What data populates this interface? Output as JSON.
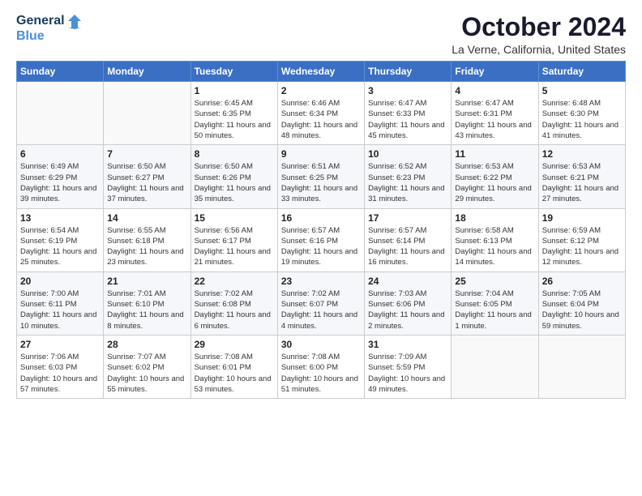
{
  "logo": {
    "text_general": "General",
    "text_blue": "Blue"
  },
  "title": "October 2024",
  "subtitle": "La Verne, California, United States",
  "days_of_week": [
    "Sunday",
    "Monday",
    "Tuesday",
    "Wednesday",
    "Thursday",
    "Friday",
    "Saturday"
  ],
  "weeks": [
    [
      {
        "day": "",
        "info": ""
      },
      {
        "day": "",
        "info": ""
      },
      {
        "day": "1",
        "info": "Sunrise: 6:45 AM\nSunset: 6:35 PM\nDaylight: 11 hours and 50 minutes."
      },
      {
        "day": "2",
        "info": "Sunrise: 6:46 AM\nSunset: 6:34 PM\nDaylight: 11 hours and 48 minutes."
      },
      {
        "day": "3",
        "info": "Sunrise: 6:47 AM\nSunset: 6:33 PM\nDaylight: 11 hours and 45 minutes."
      },
      {
        "day": "4",
        "info": "Sunrise: 6:47 AM\nSunset: 6:31 PM\nDaylight: 11 hours and 43 minutes."
      },
      {
        "day": "5",
        "info": "Sunrise: 6:48 AM\nSunset: 6:30 PM\nDaylight: 11 hours and 41 minutes."
      }
    ],
    [
      {
        "day": "6",
        "info": "Sunrise: 6:49 AM\nSunset: 6:29 PM\nDaylight: 11 hours and 39 minutes."
      },
      {
        "day": "7",
        "info": "Sunrise: 6:50 AM\nSunset: 6:27 PM\nDaylight: 11 hours and 37 minutes."
      },
      {
        "day": "8",
        "info": "Sunrise: 6:50 AM\nSunset: 6:26 PM\nDaylight: 11 hours and 35 minutes."
      },
      {
        "day": "9",
        "info": "Sunrise: 6:51 AM\nSunset: 6:25 PM\nDaylight: 11 hours and 33 minutes."
      },
      {
        "day": "10",
        "info": "Sunrise: 6:52 AM\nSunset: 6:23 PM\nDaylight: 11 hours and 31 minutes."
      },
      {
        "day": "11",
        "info": "Sunrise: 6:53 AM\nSunset: 6:22 PM\nDaylight: 11 hours and 29 minutes."
      },
      {
        "day": "12",
        "info": "Sunrise: 6:53 AM\nSunset: 6:21 PM\nDaylight: 11 hours and 27 minutes."
      }
    ],
    [
      {
        "day": "13",
        "info": "Sunrise: 6:54 AM\nSunset: 6:19 PM\nDaylight: 11 hours and 25 minutes."
      },
      {
        "day": "14",
        "info": "Sunrise: 6:55 AM\nSunset: 6:18 PM\nDaylight: 11 hours and 23 minutes."
      },
      {
        "day": "15",
        "info": "Sunrise: 6:56 AM\nSunset: 6:17 PM\nDaylight: 11 hours and 21 minutes."
      },
      {
        "day": "16",
        "info": "Sunrise: 6:57 AM\nSunset: 6:16 PM\nDaylight: 11 hours and 19 minutes."
      },
      {
        "day": "17",
        "info": "Sunrise: 6:57 AM\nSunset: 6:14 PM\nDaylight: 11 hours and 16 minutes."
      },
      {
        "day": "18",
        "info": "Sunrise: 6:58 AM\nSunset: 6:13 PM\nDaylight: 11 hours and 14 minutes."
      },
      {
        "day": "19",
        "info": "Sunrise: 6:59 AM\nSunset: 6:12 PM\nDaylight: 11 hours and 12 minutes."
      }
    ],
    [
      {
        "day": "20",
        "info": "Sunrise: 7:00 AM\nSunset: 6:11 PM\nDaylight: 11 hours and 10 minutes."
      },
      {
        "day": "21",
        "info": "Sunrise: 7:01 AM\nSunset: 6:10 PM\nDaylight: 11 hours and 8 minutes."
      },
      {
        "day": "22",
        "info": "Sunrise: 7:02 AM\nSunset: 6:08 PM\nDaylight: 11 hours and 6 minutes."
      },
      {
        "day": "23",
        "info": "Sunrise: 7:02 AM\nSunset: 6:07 PM\nDaylight: 11 hours and 4 minutes."
      },
      {
        "day": "24",
        "info": "Sunrise: 7:03 AM\nSunset: 6:06 PM\nDaylight: 11 hours and 2 minutes."
      },
      {
        "day": "25",
        "info": "Sunrise: 7:04 AM\nSunset: 6:05 PM\nDaylight: 11 hours and 1 minute."
      },
      {
        "day": "26",
        "info": "Sunrise: 7:05 AM\nSunset: 6:04 PM\nDaylight: 10 hours and 59 minutes."
      }
    ],
    [
      {
        "day": "27",
        "info": "Sunrise: 7:06 AM\nSunset: 6:03 PM\nDaylight: 10 hours and 57 minutes."
      },
      {
        "day": "28",
        "info": "Sunrise: 7:07 AM\nSunset: 6:02 PM\nDaylight: 10 hours and 55 minutes."
      },
      {
        "day": "29",
        "info": "Sunrise: 7:08 AM\nSunset: 6:01 PM\nDaylight: 10 hours and 53 minutes."
      },
      {
        "day": "30",
        "info": "Sunrise: 7:08 AM\nSunset: 6:00 PM\nDaylight: 10 hours and 51 minutes."
      },
      {
        "day": "31",
        "info": "Sunrise: 7:09 AM\nSunset: 5:59 PM\nDaylight: 10 hours and 49 minutes."
      },
      {
        "day": "",
        "info": ""
      },
      {
        "day": "",
        "info": ""
      }
    ]
  ]
}
